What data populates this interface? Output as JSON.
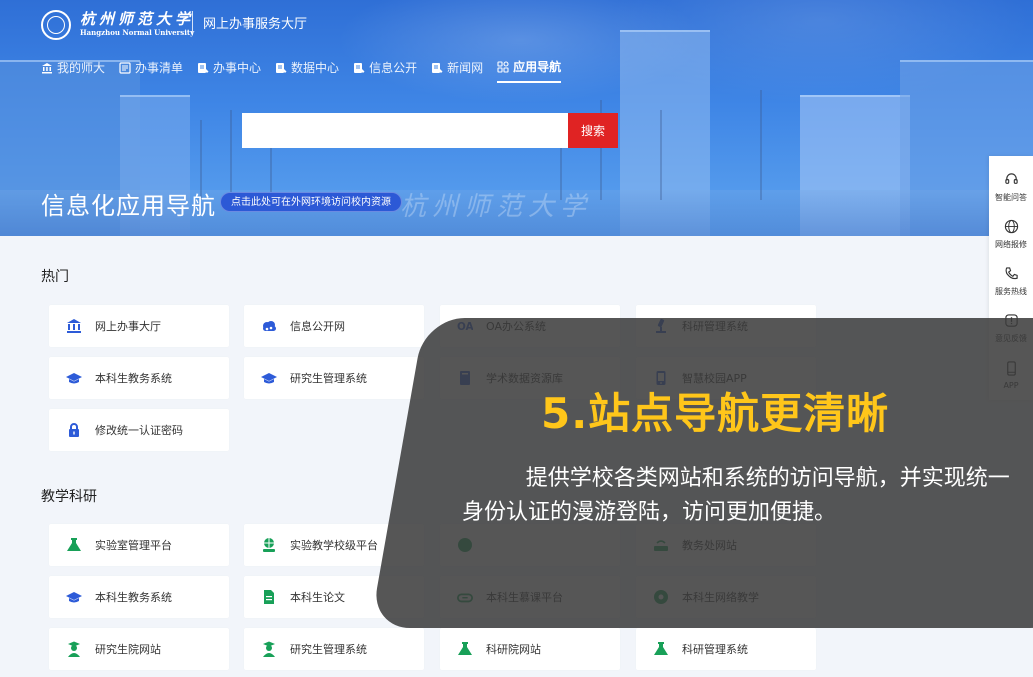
{
  "header": {
    "logo_cn": "杭州师范大学",
    "logo_en": "Hangzhou Normal University",
    "subtitle": "网上办事服务大厅"
  },
  "nav": {
    "items": [
      {
        "label": "我的师大",
        "icon": "bank-icon",
        "active": false
      },
      {
        "label": "办事清单",
        "icon": "list-icon",
        "active": false
      },
      {
        "label": "办事中心",
        "icon": "doc-pen-icon",
        "active": false
      },
      {
        "label": "数据中心",
        "icon": "doc-pen-icon",
        "active": false
      },
      {
        "label": "信息公开",
        "icon": "doc-pen-icon",
        "active": false
      },
      {
        "label": "新闻网",
        "icon": "doc-pen-icon",
        "active": false
      },
      {
        "label": "应用导航",
        "icon": "grid-icon",
        "active": true
      }
    ]
  },
  "search": {
    "placeholder": "",
    "button_label": "搜索"
  },
  "hero": {
    "title": "信息化应用导航",
    "pill_label": "点击此处可在外网环境访问校内资源",
    "watermark": "杭州师范大学"
  },
  "sidebar": {
    "items": [
      {
        "label": "智能问答",
        "icon": "headset-icon"
      },
      {
        "label": "网络报修",
        "icon": "globe-icon"
      },
      {
        "label": "服务热线",
        "icon": "phone-icon"
      },
      {
        "label": "意见反馈",
        "icon": "alert-icon"
      },
      {
        "label": "APP",
        "icon": "mobile-icon"
      }
    ]
  },
  "sections": {
    "hot": {
      "title": "热门",
      "cards": [
        {
          "label": "网上办事大厅",
          "icon": "bank-icon"
        },
        {
          "label": "信息公开网",
          "icon": "cloud-icon"
        },
        {
          "label": "OA办公系统",
          "icon": "oa-icon"
        },
        {
          "label": "科研管理系统",
          "icon": "microscope-icon"
        },
        {
          "label": "本科生教务系统",
          "icon": "graduation-cap-icon"
        },
        {
          "label": "研究生管理系统",
          "icon": "graduation-cap-icon"
        },
        {
          "label": "学术数据资源库",
          "icon": "book-icon"
        },
        {
          "label": "智慧校园APP",
          "icon": "mobile-icon"
        },
        {
          "label": "修改统一认证密码",
          "icon": "lock-icon"
        }
      ]
    },
    "research": {
      "title": "教学科研",
      "cards": [
        {
          "label": "实验室管理平台",
          "icon": "lab-icon"
        },
        {
          "label": "实验教学校级平台",
          "icon": "globe-hand-icon"
        },
        {
          "label": "",
          "icon": "circle-icon"
        },
        {
          "label": "教务处网站",
          "icon": "router-icon"
        },
        {
          "label": "本科生教务系统",
          "icon": "graduation-cap-icon"
        },
        {
          "label": "本科生论文",
          "icon": "doc-icon"
        },
        {
          "label": "本科生慕课平台",
          "icon": "cloud-outline-icon"
        },
        {
          "label": "本科生网络教学",
          "icon": "network-icon"
        },
        {
          "label": "研究生院网站",
          "icon": "person-cap-icon"
        },
        {
          "label": "研究生管理系统",
          "icon": "person-cap-icon"
        },
        {
          "label": "科研院网站",
          "icon": "lab-icon"
        },
        {
          "label": "科研管理系统",
          "icon": "lab-icon"
        }
      ]
    }
  },
  "promo": {
    "title": "5.站点导航更清晰",
    "body": "提供学校各类网站和系统的访问导航，并实现统一身份认证的漫游登陆，访问更加便捷。"
  },
  "colors": {
    "brand_blue": "#2f6fd6",
    "search_red": "#e02323",
    "promo_yellow": "#ffc61a",
    "icon_blue": "#2d5bd8",
    "icon_green": "#18a058"
  }
}
